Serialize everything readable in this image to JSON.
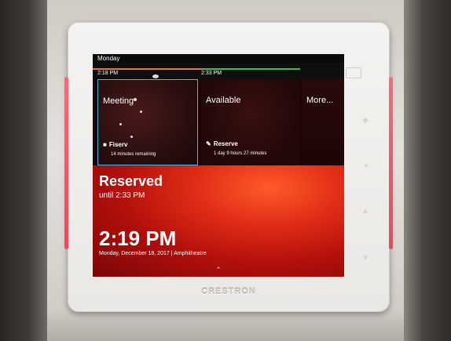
{
  "panel": {
    "brand": "CRESTRON"
  },
  "screen": {
    "day": "Monday",
    "timeline": {
      "times": [
        "2:18 PM",
        "2:33 PM"
      ]
    },
    "slots": [
      {
        "title": "Meeting",
        "organizer": "Fiserv",
        "detail": "14 minutes remaining",
        "icon": "person-icon"
      },
      {
        "title": "Available",
        "action": "Reserve",
        "detail": "1 day 9 hours 27 minutes",
        "icon": "pencil-icon"
      },
      {
        "title": "More..."
      }
    ],
    "status": {
      "title": "Reserved",
      "until": "until 2:33 PM",
      "clock": "2:19 PM",
      "date_room": "Monday, December 18, 2017  |  Amphitheatre"
    }
  },
  "colors": {
    "selected_border": "#47b7e6",
    "timeline_green": "#3fbf4a",
    "timeline_orange": "#e37d2a",
    "status_red": "#d92414",
    "accent_pink": "#f26d7d"
  }
}
